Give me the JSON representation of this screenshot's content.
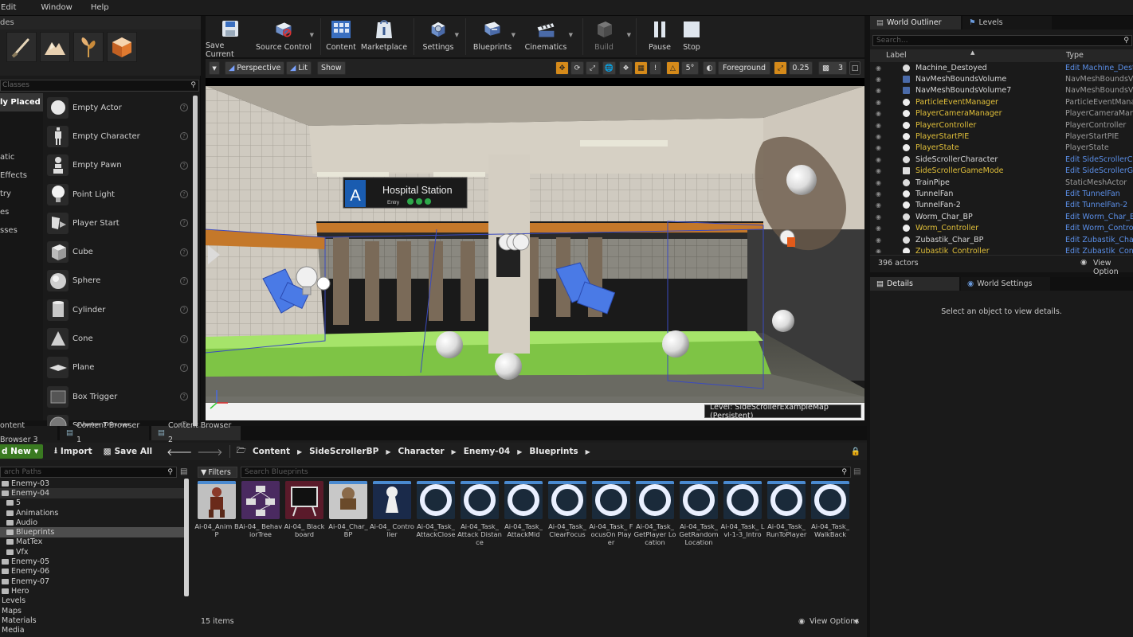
{
  "menu": {
    "items": [
      "Edit",
      "Window",
      "Help"
    ]
  },
  "modes": {
    "tab_label": "des",
    "search_placeholder": "Classes",
    "categories": [
      {
        "label": "ly Placed",
        "selected": true
      },
      {
        "label": ""
      },
      {
        "label": ""
      },
      {
        "label": "atic"
      },
      {
        "label": "Effects"
      },
      {
        "label": "try"
      },
      {
        "label": "es"
      },
      {
        "label": "sses"
      }
    ],
    "items": [
      {
        "label": "Empty Actor",
        "icon": "empty-actor-sphere-icon"
      },
      {
        "label": "Empty Character",
        "icon": "character-icon"
      },
      {
        "label": "Empty Pawn",
        "icon": "pawn-icon"
      },
      {
        "label": "Point Light",
        "icon": "light-bulb-icon"
      },
      {
        "label": "Player Start",
        "icon": "player-start-icon"
      },
      {
        "label": "Cube",
        "icon": "cube-icon"
      },
      {
        "label": "Sphere",
        "icon": "sphere-icon"
      },
      {
        "label": "Cylinder",
        "icon": "cylinder-icon"
      },
      {
        "label": "Cone",
        "icon": "cone-icon"
      },
      {
        "label": "Plane",
        "icon": "plane-icon"
      },
      {
        "label": "Box Trigger",
        "icon": "box-trigger-icon"
      },
      {
        "label": "Sphere Trigger",
        "icon": "sphere-trigger-icon"
      }
    ]
  },
  "toolbar": {
    "buttons": [
      {
        "label": "Save Current",
        "icon": "save-icon"
      },
      {
        "label": "Source Control",
        "icon": "source-control-icon"
      },
      {
        "label": "Content",
        "icon": "content-icon"
      },
      {
        "label": "Marketplace",
        "icon": "marketplace-icon"
      },
      {
        "label": "Settings",
        "icon": "settings-icon"
      },
      {
        "label": "Blueprints",
        "icon": "blueprints-icon"
      },
      {
        "label": "Cinematics",
        "icon": "cinematics-icon"
      },
      {
        "label": "Build",
        "icon": "build-icon"
      },
      {
        "label": "Pause",
        "icon": "pause-icon"
      },
      {
        "label": "Stop",
        "icon": "stop-icon"
      }
    ]
  },
  "viewport": {
    "perspective": "Perspective",
    "lit": "Lit",
    "show": "Show",
    "snap_angle": "5°",
    "layer": "Foreground",
    "scale_snap": "0.25",
    "camera_speed": "3",
    "level_label": "Level:  SideScrollerExampleMap (Persistent)",
    "sign_letter": "A",
    "sign_title": "Hospital Station",
    "sign_sub": "Entry"
  },
  "outliner": {
    "tabs": [
      "World Outliner",
      "Levels"
    ],
    "search_placeholder": "Search...",
    "col_label": "Label",
    "col_type": "Type",
    "rows": [
      {
        "name": "Machine_Destoyed",
        "type": "Edit Machine_Desto",
        "nc": "wht",
        "tc": "link"
      },
      {
        "name": "NavMeshBoundsVolume",
        "type": "NavMeshBoundsVolu",
        "nc": "wht",
        "tc": "gry"
      },
      {
        "name": "NavMeshBoundsVolume7",
        "type": "NavMeshBoundsVolu",
        "nc": "wht",
        "tc": "gry"
      },
      {
        "name": "ParticleEventManager",
        "type": "ParticleEventManager",
        "nc": "ylw",
        "tc": "gry"
      },
      {
        "name": "PlayerCameraManager",
        "type": "PlayerCameraManag",
        "nc": "ylw",
        "tc": "gry"
      },
      {
        "name": "PlayerController",
        "type": "PlayerController",
        "nc": "ylw",
        "tc": "gry"
      },
      {
        "name": "PlayerStartPIE",
        "type": "PlayerStartPIE",
        "nc": "ylw",
        "tc": "gry"
      },
      {
        "name": "PlayerState",
        "type": "PlayerState",
        "nc": "ylw",
        "tc": "gry"
      },
      {
        "name": "SideScrollerCharacter",
        "type": "Edit SideScrollerCh",
        "nc": "wht",
        "tc": "link"
      },
      {
        "name": "SideScrollerGameMode",
        "type": "Edit SideScrollerGa",
        "nc": "ylw",
        "tc": "link"
      },
      {
        "name": "TrainPipe",
        "type": "StaticMeshActor",
        "nc": "wht",
        "tc": "gry"
      },
      {
        "name": "TunnelFan",
        "type": "Edit TunnelFan",
        "nc": "wht",
        "tc": "link"
      },
      {
        "name": "TunnelFan-2",
        "type": "Edit TunnelFan-2",
        "nc": "wht",
        "tc": "link"
      },
      {
        "name": "Worm_Char_BP",
        "type": "Edit Worm_Char_BP",
        "nc": "wht",
        "tc": "link"
      },
      {
        "name": "Worm_Controller",
        "type": "Edit Worm_Controlle",
        "nc": "ylw",
        "tc": "link"
      },
      {
        "name": "Zubastik_Char_BP",
        "type": "Edit Zubastik_Char_",
        "nc": "wht",
        "tc": "link"
      },
      {
        "name": "Zubastik_Controller",
        "type": "Edit Zubastik_Contr",
        "nc": "ylw",
        "tc": "link"
      }
    ],
    "actor_count": "396 actors",
    "view_options": "View Option"
  },
  "details": {
    "tabs": [
      "Details",
      "World Settings"
    ],
    "empty_message": "Select an object to view details."
  },
  "content_browser": {
    "tabs": [
      "ontent Browser 3",
      "Content Browser 1",
      "Content Browser 2"
    ],
    "add_new": "d New",
    "import": "Import",
    "save_all": "Save All",
    "breadcrumb": [
      "Content",
      "SideScrollerBP",
      "Character",
      "Enemy-04",
      "Blueprints"
    ],
    "path_search": "arch Paths",
    "filters": "Filters",
    "asset_search": "Search Blueprints",
    "tree": [
      {
        "label": "Enemy-03",
        "indent": 1,
        "sel": false
      },
      {
        "label": "Enemy-04",
        "indent": 1,
        "sel": false,
        "hl": true
      },
      {
        "label": "5",
        "indent": 2,
        "sel": false
      },
      {
        "label": "Animations",
        "indent": 2,
        "sel": false
      },
      {
        "label": "Audio",
        "indent": 2,
        "sel": false
      },
      {
        "label": "Blueprints",
        "indent": 2,
        "sel": true
      },
      {
        "label": "MatTex",
        "indent": 2,
        "sel": false
      },
      {
        "label": "Vfx",
        "indent": 2,
        "sel": false
      },
      {
        "label": "Enemy-05",
        "indent": 1,
        "sel": false
      },
      {
        "label": "Enemy-06",
        "indent": 1,
        "sel": false
      },
      {
        "label": "Enemy-07",
        "indent": 1,
        "sel": false
      },
      {
        "label": "Hero",
        "indent": 1,
        "sel": false
      },
      {
        "label": "Levels",
        "indent": 0,
        "sel": false
      },
      {
        "label": "Maps",
        "indent": 0,
        "sel": false
      },
      {
        "label": "Materials",
        "indent": 0,
        "sel": false
      },
      {
        "label": "Media",
        "indent": 0,
        "sel": false
      }
    ],
    "assets": [
      {
        "name": "Ai-04_Anim BP",
        "kind": "anim"
      },
      {
        "name": "Ai-04_ BehaviorTree",
        "kind": "tree"
      },
      {
        "name": "Ai-04_ Blackboard",
        "kind": "board"
      },
      {
        "name": "Ai-04_Char_ BP",
        "kind": "char"
      },
      {
        "name": "Ai-04_ Controller",
        "kind": "ctrl"
      },
      {
        "name": "Ai-04_Task_ AttackClose",
        "kind": "task"
      },
      {
        "name": "Ai-04_Task_ Attack Distance",
        "kind": "task"
      },
      {
        "name": "Ai-04_Task_ AttackMid",
        "kind": "task"
      },
      {
        "name": "Ai-04_Task_ ClearFocus",
        "kind": "task"
      },
      {
        "name": "Ai-04_Task_ FocusOn Player",
        "kind": "task"
      },
      {
        "name": "Ai-04_Task_ GetPlayer Location",
        "kind": "task"
      },
      {
        "name": "Ai-04_Task_ GetRandom Location",
        "kind": "task"
      },
      {
        "name": "Ai-04_Task_ Lvl-1-3_Intro",
        "kind": "task"
      },
      {
        "name": "Ai-04_Task_ RunToPlayer",
        "kind": "task"
      },
      {
        "name": "Ai-04_Task_ WalkBack",
        "kind": "task"
      }
    ],
    "item_count": "15 items",
    "view_options": "View Options"
  }
}
